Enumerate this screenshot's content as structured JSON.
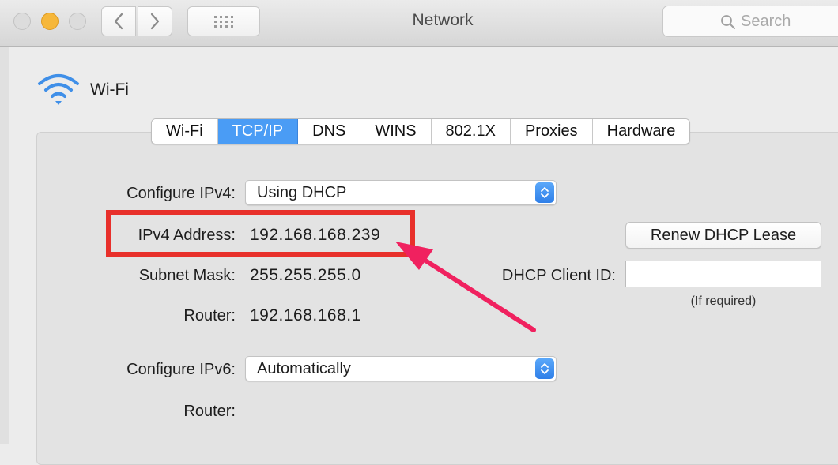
{
  "window": {
    "title": "Network"
  },
  "toolbar": {
    "back_icon": "chevron-left-icon",
    "forward_icon": "chevron-right-icon",
    "grid_icon": "grid-icon",
    "search_placeholder": "Search"
  },
  "interface": {
    "name": "Wi-Fi",
    "icon": "wifi-icon"
  },
  "tabs": [
    {
      "label": "Wi-Fi",
      "active": false
    },
    {
      "label": "TCP/IP",
      "active": true
    },
    {
      "label": "DNS",
      "active": false
    },
    {
      "label": "WINS",
      "active": false
    },
    {
      "label": "802.1X",
      "active": false
    },
    {
      "label": "Proxies",
      "active": false
    },
    {
      "label": "Hardware",
      "active": false
    }
  ],
  "tcpip": {
    "configure_ipv4_label": "Configure IPv4:",
    "configure_ipv4_value": "Using DHCP",
    "ipv4_address_label": "IPv4 Address:",
    "ipv4_address_value": "192.168.168.239",
    "subnet_mask_label": "Subnet Mask:",
    "subnet_mask_value": "255.255.255.0",
    "router_label": "Router:",
    "router_value": "192.168.168.1",
    "renew_button": "Renew DHCP Lease",
    "dhcp_client_id_label": "DHCP Client ID:",
    "dhcp_client_id_value": "",
    "dhcp_client_id_hint": "(If required)",
    "configure_ipv6_label": "Configure IPv6:",
    "configure_ipv6_value": "Automatically",
    "router6_label": "Router:"
  },
  "annotation": {
    "highlight_color": "#e8302b",
    "arrow_color": "#f0215f"
  },
  "colors": {
    "accent": "#4a9cf5",
    "minimize": "#f6b73a"
  }
}
